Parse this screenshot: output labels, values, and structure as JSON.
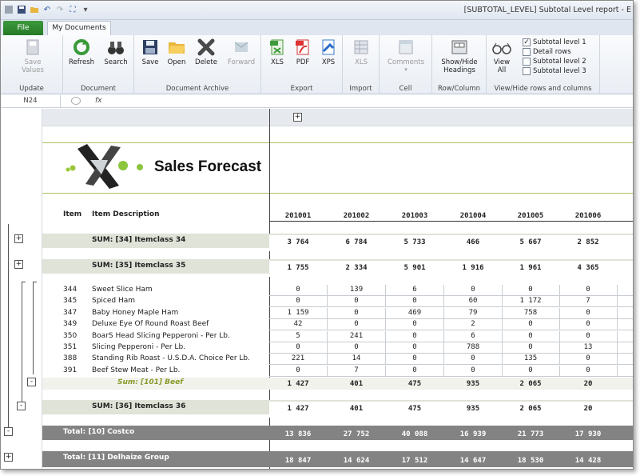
{
  "window_title": "[SUBTOTAL_LEVEL] Subtotal Level report - E",
  "tabs": {
    "file": "File",
    "doc": "My Documents"
  },
  "ribbon": {
    "groups": [
      {
        "label": "Update",
        "buttons": [
          {
            "label": "Save\nValues",
            "icon": "save-values-icon",
            "disabled": true
          }
        ]
      },
      {
        "label": "Document",
        "buttons": [
          {
            "label": "Refresh",
            "icon": "refresh-icon"
          },
          {
            "label": "Search",
            "icon": "binoculars-icon"
          }
        ]
      },
      {
        "label": "Document Archive",
        "buttons": [
          {
            "label": "Save",
            "icon": "floppy-icon"
          },
          {
            "label": "Open",
            "icon": "folder-icon"
          },
          {
            "label": "Delete",
            "icon": "delete-x-icon"
          },
          {
            "label": "Forward",
            "icon": "forward-icon",
            "disabled": true
          }
        ]
      },
      {
        "label": "Export",
        "buttons": [
          {
            "label": "XLS",
            "icon": "xls-icon"
          },
          {
            "label": "PDF",
            "icon": "pdf-icon"
          },
          {
            "label": "XPS",
            "icon": "xps-icon"
          }
        ]
      },
      {
        "label": "Import",
        "buttons": [
          {
            "label": "XLS",
            "icon": "import-xls-icon",
            "disabled": true
          }
        ]
      },
      {
        "label": "Cell",
        "buttons": [
          {
            "label": "Comments",
            "icon": "comments-icon",
            "disabled": true
          }
        ]
      },
      {
        "label": "Row/Column",
        "buttons": [
          {
            "label": "Show/Hide\nHeadings",
            "icon": "headings-icon"
          }
        ]
      },
      {
        "label": "View/Hide rows and columns",
        "buttons": [
          {
            "label": "View\nAll",
            "icon": "glasses-icon"
          }
        ]
      }
    ],
    "checkboxes": [
      {
        "label": "Subtotal level 1",
        "checked": true
      },
      {
        "label": "Detail rows",
        "checked": false
      },
      {
        "label": "Subtotal level 2",
        "checked": false
      },
      {
        "label": "Subtotal level 3",
        "checked": false
      }
    ]
  },
  "formula_bar": {
    "cell_ref": "N24",
    "fx": "fx"
  },
  "report": {
    "title": "Sales Forecast",
    "headers": {
      "item": "Item",
      "desc": "Item Description",
      "periods": [
        "201001",
        "201002",
        "201003",
        "201004",
        "201005",
        "201006"
      ]
    },
    "sum34": {
      "label": "SUM: [34] Itemclass 34",
      "values": [
        "3 764",
        "6 784",
        "5 733",
        "466",
        "5 667",
        "2 852"
      ]
    },
    "sum35": {
      "label": "SUM: [35] Itemclass 35",
      "values": [
        "1 755",
        "2 334",
        "5 901",
        "1 916",
        "1 961",
        "4 365"
      ]
    },
    "details": [
      {
        "item": "344",
        "desc": "Sweet Slice Ham",
        "values": [
          "0",
          "139",
          "6",
          "0",
          "0",
          "0"
        ]
      },
      {
        "item": "345",
        "desc": "Spiced Ham",
        "values": [
          "0",
          "0",
          "0",
          "60",
          "1 172",
          "7"
        ]
      },
      {
        "item": "347",
        "desc": "Baby Honey Maple Ham",
        "values": [
          "1 159",
          "0",
          "469",
          "79",
          "758",
          "0"
        ]
      },
      {
        "item": "349",
        "desc": "Deluxe Eye Of Round Roast Beef",
        "values": [
          "42",
          "0",
          "0",
          "2",
          "0",
          "0"
        ]
      },
      {
        "item": "350",
        "desc": "BoarS Head Slicing Pepperoni - Per Lb.",
        "values": [
          "5",
          "241",
          "0",
          "6",
          "0",
          "0"
        ]
      },
      {
        "item": "351",
        "desc": "Slicing Pepperoni - Per Lb.",
        "values": [
          "0",
          "0",
          "0",
          "788",
          "0",
          "13"
        ]
      },
      {
        "item": "388",
        "desc": "Standing Rib Roast - U.S.D.A. Choice Per Lb.",
        "values": [
          "221",
          "14",
          "0",
          "0",
          "135",
          "0"
        ]
      },
      {
        "item": "391",
        "desc": "Beef Stew Meat - Per Lb.",
        "values": [
          "0",
          "7",
          "0",
          "0",
          "0",
          "0"
        ]
      }
    ],
    "sum101": {
      "label": "Sum: [101] Beef",
      "values": [
        "1 427",
        "401",
        "475",
        "935",
        "2 065",
        "20"
      ]
    },
    "sum36": {
      "label": "SUM: [36] Itemclass 36",
      "values": [
        "1 427",
        "401",
        "475",
        "935",
        "2 065",
        "20"
      ]
    },
    "total10": {
      "label": "Total: [10] Costco",
      "values": [
        "13 836",
        "27 752",
        "40 088",
        "16 939",
        "21 773",
        "17 930"
      ]
    },
    "total11": {
      "label": "Total: [11] Delhaize Group",
      "values": [
        "18 847",
        "14 624",
        "17 512",
        "14 647",
        "18 530",
        "14 428"
      ]
    }
  }
}
